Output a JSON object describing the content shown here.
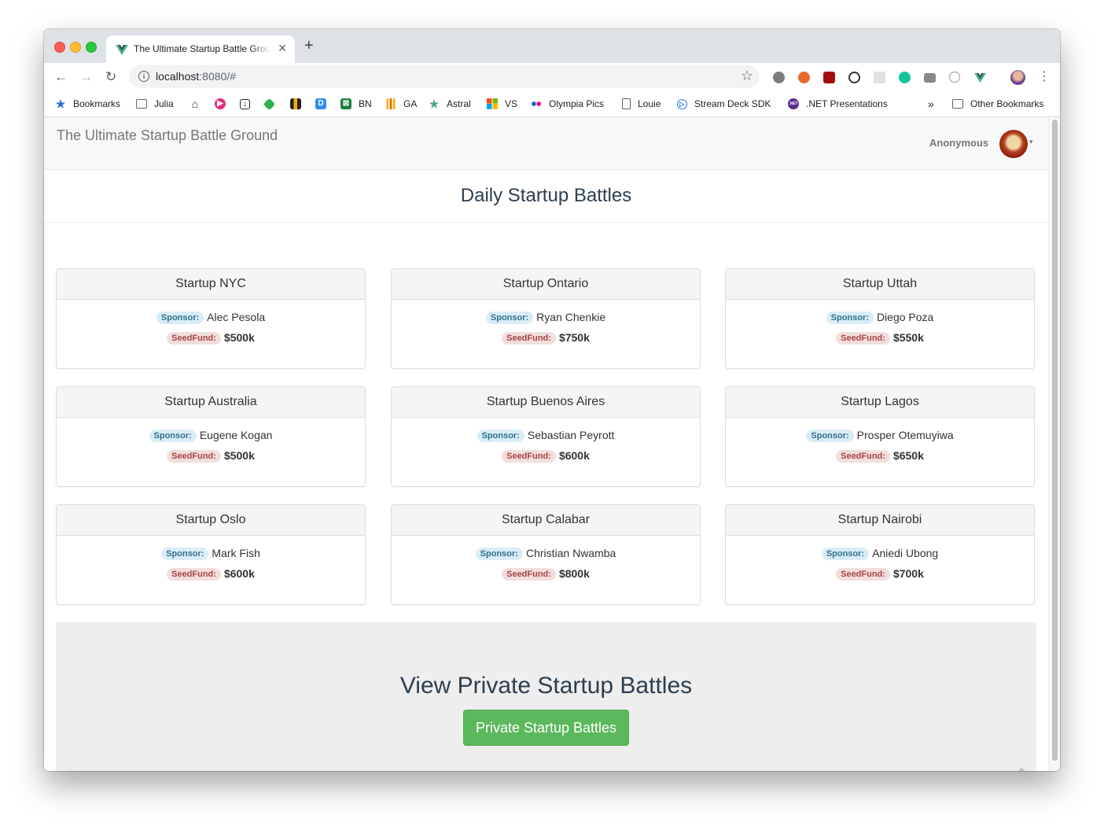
{
  "browser": {
    "tab_title": "The Ultimate Startup Battle Ground",
    "tab_close": "✕",
    "new_tab": "+",
    "url_host": "localhost",
    "url_rest": ":8080/#",
    "back": "←",
    "forward": "→",
    "reload": "↻",
    "star": "☆",
    "menu": "⋮",
    "bookmarks": [
      {
        "label": "Bookmarks",
        "icon": "star-icon",
        "color": "#1a73e8"
      },
      {
        "label": "Julia",
        "icon": "folder-icon",
        "color": "#5f6368"
      },
      {
        "label": "",
        "icon": "home-icon",
        "color": "#202124"
      },
      {
        "label": "",
        "icon": "play-icon",
        "color": "#e8297d"
      },
      {
        "label": "",
        "icon": "download-icon",
        "color": "#202124"
      },
      {
        "label": "",
        "icon": "feedly-icon",
        "color": "#2bb24c"
      },
      {
        "label": "",
        "icon": "books-icon",
        "color": "#202124"
      },
      {
        "label": "",
        "icon": "d-icon",
        "color": "#2d8ef0"
      },
      {
        "label": "BN",
        "icon": "bn-icon",
        "color": "#1e7f3d"
      },
      {
        "label": "GA",
        "icon": "analytics-icon",
        "color": "#f9ab00"
      },
      {
        "label": "Astral",
        "icon": "astral-icon",
        "color": "#4fa37e"
      },
      {
        "label": "VS",
        "icon": "microsoft-icon",
        "color": "#f25022"
      },
      {
        "label": "Olympia Pics",
        "icon": "flickr-icon",
        "color": "#0063dc"
      },
      {
        "label": "Louie",
        "icon": "page-icon",
        "color": "#5f6368"
      },
      {
        "label": "Stream Deck SDK",
        "icon": "streamdeck-icon",
        "color": "#1a73e8"
      },
      {
        "label": ".NET Presentations",
        "icon": "dotnet-icon",
        "color": "#5c2d91"
      }
    ],
    "more_bookmarks": "»",
    "other_bookmarks": "Other Bookmarks"
  },
  "app": {
    "brand": "The Ultimate Startup Battle Ground",
    "user": "Anonymous",
    "caret": "▾",
    "page_title": "Daily Startup Battles",
    "sponsor_label": "Sponsor:",
    "seed_label": "SeedFund:",
    "battles": [
      {
        "name": "Startup NYC",
        "sponsor": "Alec Pesola",
        "seed": "$500k"
      },
      {
        "name": "Startup Ontario",
        "sponsor": "Ryan Chenkie",
        "seed": "$750k"
      },
      {
        "name": "Startup Uttah",
        "sponsor": "Diego Poza",
        "seed": "$550k"
      },
      {
        "name": "Startup Australia",
        "sponsor": "Eugene Kogan",
        "seed": "$500k"
      },
      {
        "name": "Startup Buenos Aires",
        "sponsor": "Sebastian Peyrott",
        "seed": "$600k"
      },
      {
        "name": "Startup Lagos",
        "sponsor": "Prosper Otemuyiwa",
        "seed": "$650k"
      },
      {
        "name": "Startup Oslo",
        "sponsor": "Mark Fish",
        "seed": "$600k"
      },
      {
        "name": "Startup Calabar",
        "sponsor": "Christian Nwamba",
        "seed": "$800k"
      },
      {
        "name": "Startup Nairobi",
        "sponsor": "Aniedi Ubong",
        "seed": "$700k"
      }
    ],
    "private_title": "View Private Startup Battles",
    "private_button": "Private Startup Battles"
  }
}
